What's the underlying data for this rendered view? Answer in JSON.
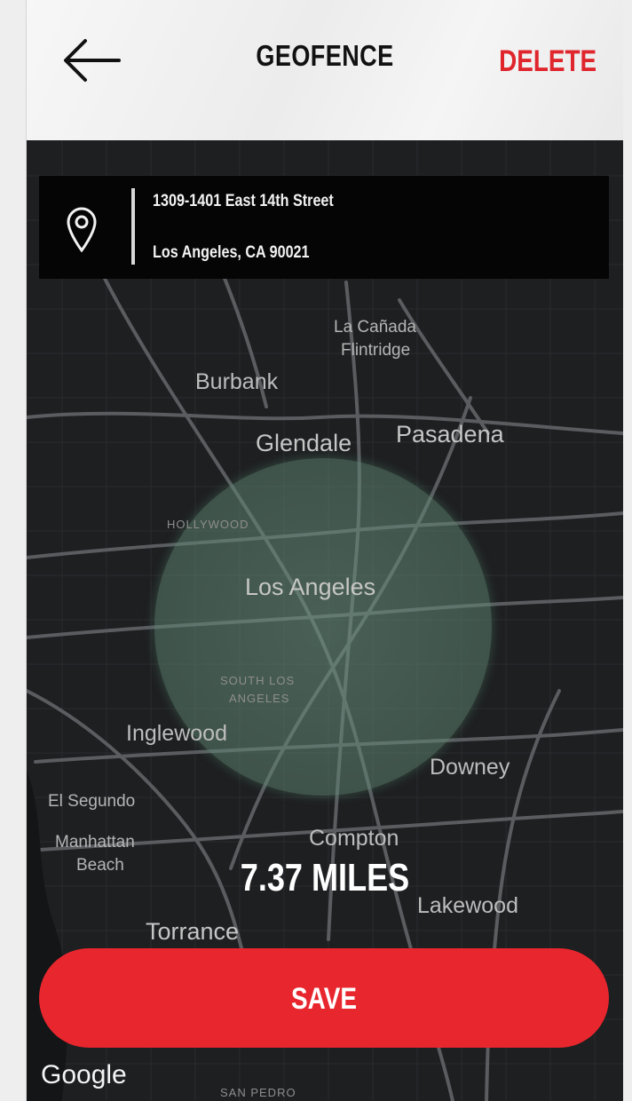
{
  "header": {
    "title": "GEOFENCE",
    "back_icon": "arrow-left-icon",
    "delete_label": "DELETE",
    "delete_color": "#e0262d"
  },
  "address": {
    "icon": "map-pin-icon",
    "line1": "1309-1401 East 14th Street",
    "line2": "Los Angeles, CA 90021"
  },
  "map": {
    "places": {
      "la_canada_1": "La Cañada",
      "la_canada_2": "Flintridge",
      "burbank": "Burbank",
      "glendale": "Glendale",
      "pasadena": "Pasadena",
      "hollywood": "HOLLYWOOD",
      "los_angeles": "Los Angeles",
      "south_la_1": "SOUTH LOS",
      "south_la_2": "ANGELES",
      "inglewood": "Inglewood",
      "downey": "Downey",
      "el_segundo": "El Segundo",
      "manhattan_1": "Manhattan",
      "manhattan_2": "Beach",
      "compton": "Compton",
      "lakewood": "Lakewood",
      "torrance": "Torrance",
      "san_pedro": "SAN PEDRO"
    },
    "geofence_color": "#5f8a74",
    "attribution": "Google"
  },
  "distance_label": "7.37 MILES",
  "save": {
    "label": "SAVE",
    "color": "#e8262e"
  }
}
